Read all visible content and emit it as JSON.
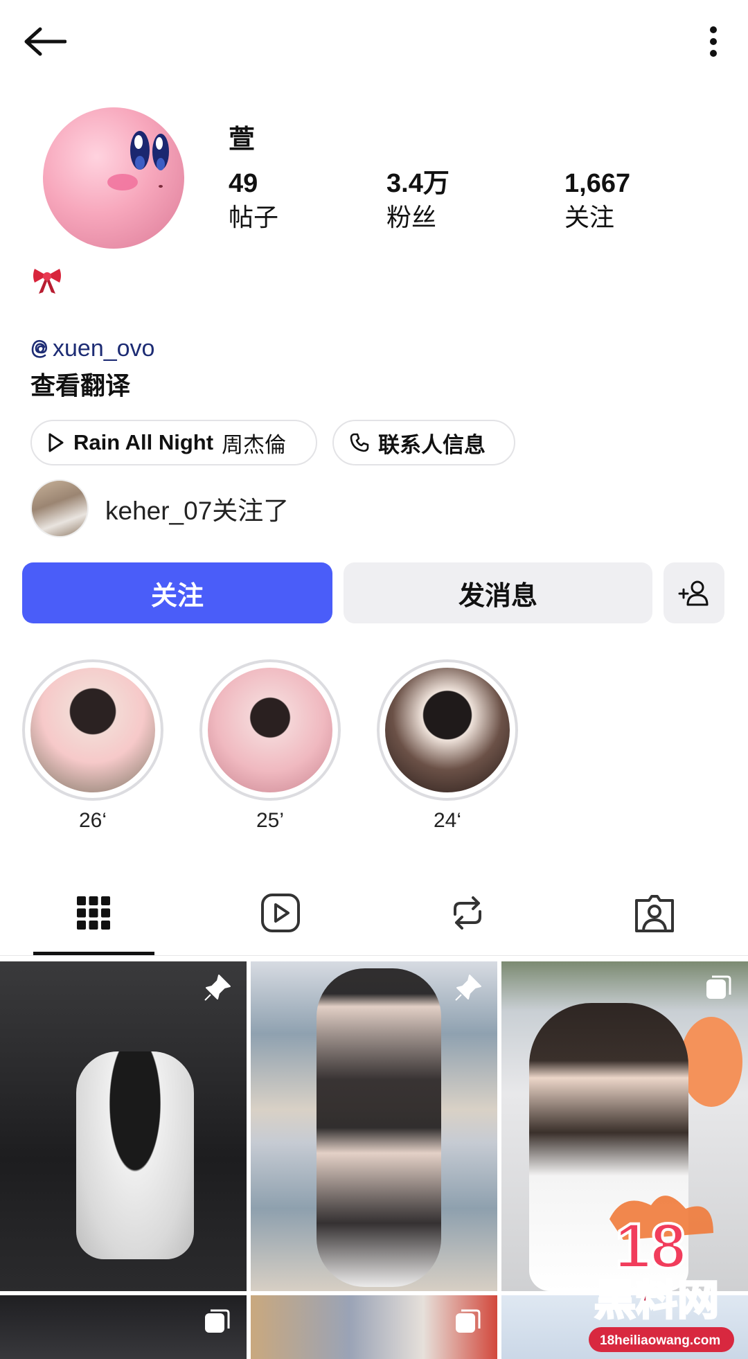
{
  "header": {
    "back_icon": "arrow-left-icon",
    "more_icon": "more-vertical-icon"
  },
  "profile": {
    "name": "萱",
    "stats": [
      {
        "value": "49",
        "label": "帖子"
      },
      {
        "value": "3.4万",
        "label": "粉丝"
      },
      {
        "value": "1,667",
        "label": "关注"
      }
    ],
    "bio_emoji": "🎀",
    "threads_handle": "xuen_ovo",
    "translate_label": "查看翻译"
  },
  "chips": {
    "music_song": "Rain All Night",
    "music_artist": "周杰倫",
    "contact_label": "联系人信息"
  },
  "mutual": {
    "text": "keher_07关注了"
  },
  "actions": {
    "follow_label": "关注",
    "message_label": "发消息"
  },
  "highlights": [
    {
      "label": "26‘"
    },
    {
      "label": "25’"
    },
    {
      "label": "24‘"
    }
  ],
  "tabs": [
    "grid-icon",
    "reels-icon",
    "reposts-icon",
    "tagged-icon"
  ],
  "colors": {
    "primary": "#4a5df9",
    "secondary_button": "#efeff2",
    "threads_link": "#1d2c74"
  },
  "watermark": {
    "number": "18",
    "name": "黑料网",
    "url": "18heiliaowang.com"
  }
}
